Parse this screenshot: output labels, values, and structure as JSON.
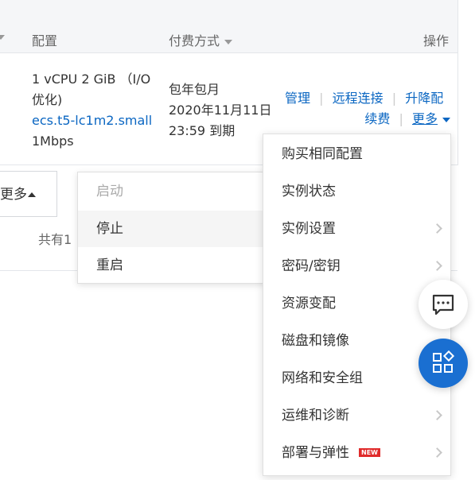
{
  "table_header": {
    "col_config": "配置",
    "col_billing": "付费方式",
    "col_actions": "操作"
  },
  "row": {
    "spec_line1": "1 vCPU 2 GiB （I/O",
    "spec_line2": "优化)",
    "instance_type": "ecs.t5-lc1m2.small",
    "bandwidth": "1Mbps",
    "billing_type": "包年包月",
    "expire_date": "2020年11月11日",
    "expire_time": "23:59 到期",
    "actions": {
      "manage": "管理",
      "remote": "远程连接",
      "upgrade": "升降配",
      "renew": "续费",
      "more": "更多"
    }
  },
  "bottom": {
    "more_button": "更多",
    "total_text": "共有1"
  },
  "popup_small": {
    "items": [
      {
        "label": "启动",
        "disabled": true
      },
      {
        "label": "停止",
        "disabled": false
      },
      {
        "label": "重启",
        "disabled": false
      }
    ]
  },
  "menu_big": {
    "items": [
      {
        "label": "购买相同配置",
        "submenu": false
      },
      {
        "label": "实例状态",
        "submenu": false
      },
      {
        "label": "实例设置",
        "submenu": true
      },
      {
        "label": "密码/密钥",
        "submenu": true
      },
      {
        "label": "资源变配",
        "submenu": false
      },
      {
        "label": "磁盘和镜像",
        "submenu": false
      },
      {
        "label": "网络和安全组",
        "submenu": false
      },
      {
        "label": "运维和诊断",
        "submenu": true
      },
      {
        "label": "部署与弹性",
        "submenu": true,
        "badge": "NEW"
      }
    ]
  },
  "colors": {
    "link": "#0a66c2",
    "fab_blue": "#1a6fd1",
    "badge_red": "#e02b2b"
  },
  "icons": {
    "chat": "chat-bubble-icon",
    "apps": "apps-grid-icon"
  }
}
